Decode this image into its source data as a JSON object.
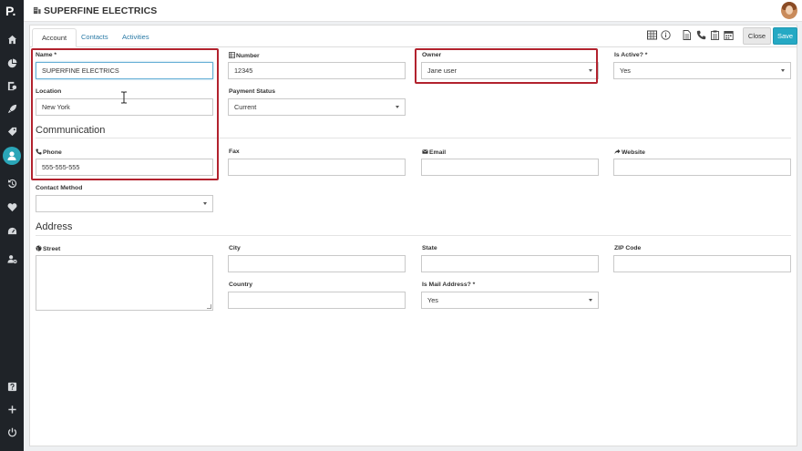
{
  "app": {
    "logo": "P."
  },
  "header": {
    "title": "SUPERFINE ELECTRICS"
  },
  "tabs": [
    {
      "label": "Account"
    },
    {
      "label": "Contacts"
    },
    {
      "label": "Activities"
    }
  ],
  "buttons": {
    "close": "Close",
    "save": "Save"
  },
  "form": {
    "name": {
      "label": "Name *",
      "value": "SUPERFINE ELECTRICS"
    },
    "number": {
      "label": "Number",
      "value": "12345"
    },
    "owner": {
      "label": "Owner",
      "value": "Jane user"
    },
    "is_active": {
      "label": "Is Active? *",
      "value": "Yes"
    },
    "location": {
      "label": "Location",
      "value": "New York"
    },
    "payment_status": {
      "label": "Payment Status",
      "value": "Current"
    },
    "communication_heading": "Communication",
    "phone": {
      "label": "Phone",
      "value": "555-555-555"
    },
    "fax": {
      "label": "Fax",
      "value": ""
    },
    "email": {
      "label": "Email",
      "value": ""
    },
    "website": {
      "label": "Website",
      "value": ""
    },
    "contact_method": {
      "label": "Contact Method",
      "value": ""
    },
    "address_heading": "Address",
    "street": {
      "label": "Street",
      "value": ""
    },
    "city": {
      "label": "City",
      "value": ""
    },
    "state": {
      "label": "State",
      "value": ""
    },
    "zip": {
      "label": "ZIP Code",
      "value": ""
    },
    "country": {
      "label": "Country",
      "value": ""
    },
    "is_mail_address": {
      "label": "Is Mail Address? *",
      "value": "Yes"
    }
  },
  "colors": {
    "accent": "#25a9c4",
    "highlight": "#b2222e",
    "sidebar": "#1f2328"
  },
  "icons": {
    "sidebar": [
      "home-icon",
      "pie-chart-icon",
      "reports-icon",
      "rocket-icon",
      "tag-icon",
      "user-icon",
      "history-icon",
      "heart-icon",
      "gauge-icon",
      "user-settings-icon",
      "help-icon",
      "plus-icon",
      "power-icon"
    ],
    "toolbar": [
      "table-icon",
      "info-icon",
      "document-icon",
      "phone-icon",
      "clipboard-icon",
      "calendar-icon"
    ]
  }
}
